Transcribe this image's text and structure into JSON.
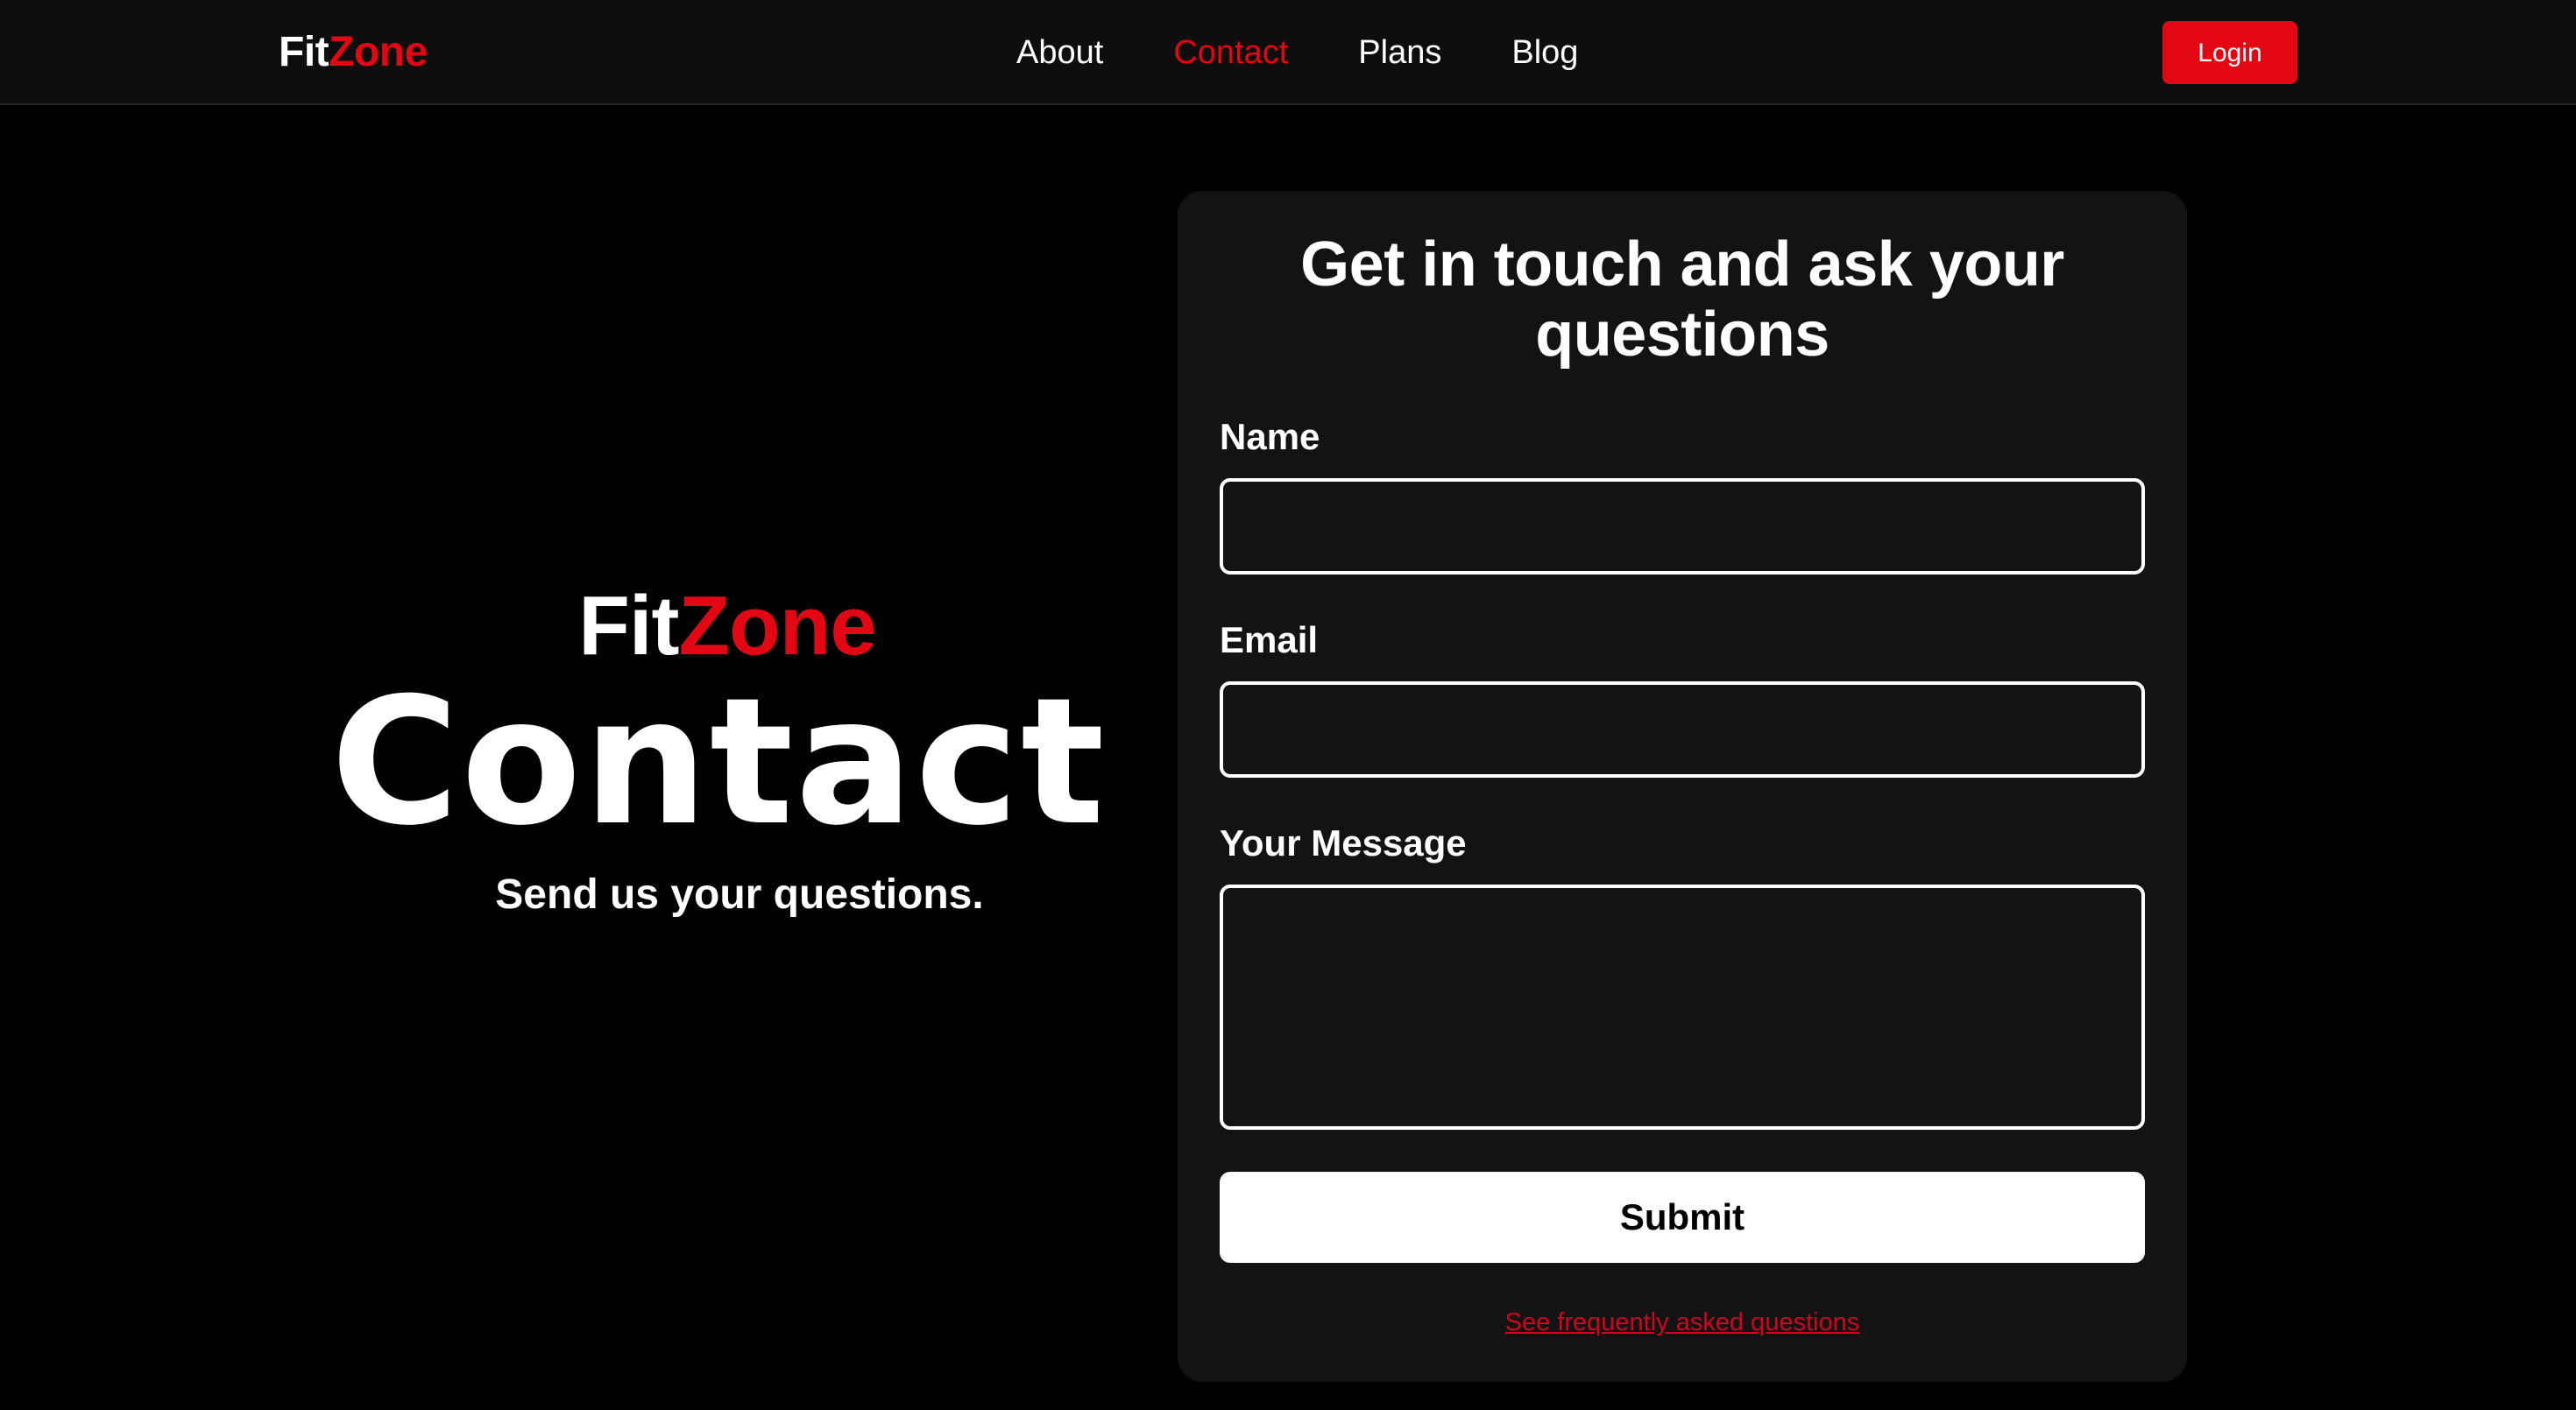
{
  "brand": {
    "part1": "Fit",
    "part2": "Zone"
  },
  "nav": {
    "links": [
      {
        "label": "About"
      },
      {
        "label": "Contact"
      },
      {
        "label": "Plans"
      },
      {
        "label": "Blog"
      }
    ],
    "active": "Contact",
    "login_label": "Login"
  },
  "hero": {
    "brand_part1": "Fit",
    "brand_part2": "Zone",
    "title": "Contact",
    "subtitle": "Send us your questions."
  },
  "form": {
    "title": "Get in touch and ask your questions",
    "name_label": "Name",
    "name_value": "",
    "email_label": "Email",
    "email_value": "",
    "message_label": "Your Message",
    "message_value": "",
    "submit_label": "Submit",
    "faq_link": "See frequently asked questions"
  },
  "colors": {
    "accent": "#e30613",
    "background": "#000000",
    "navbar": "#0e0e0e",
    "card": "#131313"
  }
}
